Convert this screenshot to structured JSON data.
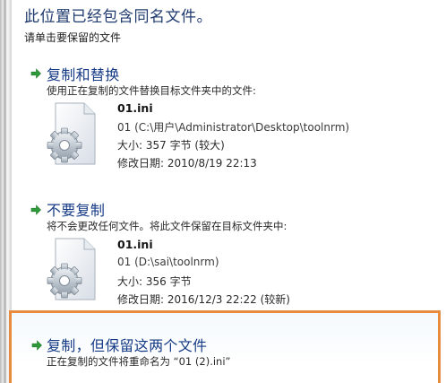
{
  "dialog": {
    "heading": "此位置已经包含同名文件。",
    "subheading": "请单击要保留的文件"
  },
  "options": {
    "replace": {
      "title": "复制和替换",
      "desc": "使用正在复制的文件替换目标文件夹中的文件:",
      "file": {
        "name": "01.ini",
        "path": "01 (C:\\用户\\Administrator\\Desktop\\toolnrm)",
        "size": "大小: 357 字节 (较大)",
        "modified": "修改日期: 2010/8/19 22:13"
      }
    },
    "skip": {
      "title": "不要复制",
      "desc": "将不会更改任何文件。将此文件保留在目标文件夹中:",
      "file": {
        "name": "01.ini",
        "path": "01 (D:\\sai\\toolnrm)",
        "size": "大小: 356 字节",
        "modified": "修改日期: 2016/12/3 22:22 (较新)"
      }
    },
    "keep_both": {
      "title": "复制，但保留这两个文件",
      "desc": "正在复制的文件将重命名为 “01 (2).ini”"
    }
  },
  "colors": {
    "title_blue": "#163b86",
    "arrow_green": "#2f9a3a",
    "highlight_orange": "#e78b3e"
  },
  "icons": {
    "option_arrow": "green-arrow-icon",
    "file": "settings-file-icon"
  }
}
